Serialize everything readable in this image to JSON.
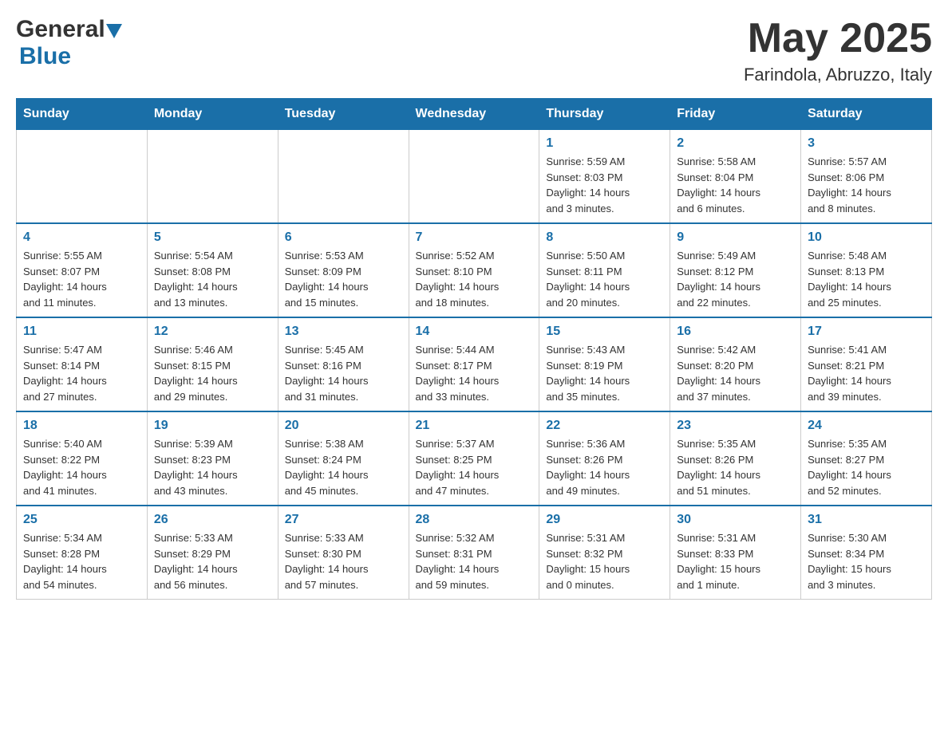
{
  "header": {
    "title": "May 2025",
    "subtitle": "Farindola, Abruzzo, Italy",
    "logo_general": "General",
    "logo_blue": "Blue"
  },
  "weekdays": [
    "Sunday",
    "Monday",
    "Tuesday",
    "Wednesday",
    "Thursday",
    "Friday",
    "Saturday"
  ],
  "weeks": [
    [
      {
        "day": "",
        "info": ""
      },
      {
        "day": "",
        "info": ""
      },
      {
        "day": "",
        "info": ""
      },
      {
        "day": "",
        "info": ""
      },
      {
        "day": "1",
        "info": "Sunrise: 5:59 AM\nSunset: 8:03 PM\nDaylight: 14 hours\nand 3 minutes."
      },
      {
        "day": "2",
        "info": "Sunrise: 5:58 AM\nSunset: 8:04 PM\nDaylight: 14 hours\nand 6 minutes."
      },
      {
        "day": "3",
        "info": "Sunrise: 5:57 AM\nSunset: 8:06 PM\nDaylight: 14 hours\nand 8 minutes."
      }
    ],
    [
      {
        "day": "4",
        "info": "Sunrise: 5:55 AM\nSunset: 8:07 PM\nDaylight: 14 hours\nand 11 minutes."
      },
      {
        "day": "5",
        "info": "Sunrise: 5:54 AM\nSunset: 8:08 PM\nDaylight: 14 hours\nand 13 minutes."
      },
      {
        "day": "6",
        "info": "Sunrise: 5:53 AM\nSunset: 8:09 PM\nDaylight: 14 hours\nand 15 minutes."
      },
      {
        "day": "7",
        "info": "Sunrise: 5:52 AM\nSunset: 8:10 PM\nDaylight: 14 hours\nand 18 minutes."
      },
      {
        "day": "8",
        "info": "Sunrise: 5:50 AM\nSunset: 8:11 PM\nDaylight: 14 hours\nand 20 minutes."
      },
      {
        "day": "9",
        "info": "Sunrise: 5:49 AM\nSunset: 8:12 PM\nDaylight: 14 hours\nand 22 minutes."
      },
      {
        "day": "10",
        "info": "Sunrise: 5:48 AM\nSunset: 8:13 PM\nDaylight: 14 hours\nand 25 minutes."
      }
    ],
    [
      {
        "day": "11",
        "info": "Sunrise: 5:47 AM\nSunset: 8:14 PM\nDaylight: 14 hours\nand 27 minutes."
      },
      {
        "day": "12",
        "info": "Sunrise: 5:46 AM\nSunset: 8:15 PM\nDaylight: 14 hours\nand 29 minutes."
      },
      {
        "day": "13",
        "info": "Sunrise: 5:45 AM\nSunset: 8:16 PM\nDaylight: 14 hours\nand 31 minutes."
      },
      {
        "day": "14",
        "info": "Sunrise: 5:44 AM\nSunset: 8:17 PM\nDaylight: 14 hours\nand 33 minutes."
      },
      {
        "day": "15",
        "info": "Sunrise: 5:43 AM\nSunset: 8:19 PM\nDaylight: 14 hours\nand 35 minutes."
      },
      {
        "day": "16",
        "info": "Sunrise: 5:42 AM\nSunset: 8:20 PM\nDaylight: 14 hours\nand 37 minutes."
      },
      {
        "day": "17",
        "info": "Sunrise: 5:41 AM\nSunset: 8:21 PM\nDaylight: 14 hours\nand 39 minutes."
      }
    ],
    [
      {
        "day": "18",
        "info": "Sunrise: 5:40 AM\nSunset: 8:22 PM\nDaylight: 14 hours\nand 41 minutes."
      },
      {
        "day": "19",
        "info": "Sunrise: 5:39 AM\nSunset: 8:23 PM\nDaylight: 14 hours\nand 43 minutes."
      },
      {
        "day": "20",
        "info": "Sunrise: 5:38 AM\nSunset: 8:24 PM\nDaylight: 14 hours\nand 45 minutes."
      },
      {
        "day": "21",
        "info": "Sunrise: 5:37 AM\nSunset: 8:25 PM\nDaylight: 14 hours\nand 47 minutes."
      },
      {
        "day": "22",
        "info": "Sunrise: 5:36 AM\nSunset: 8:26 PM\nDaylight: 14 hours\nand 49 minutes."
      },
      {
        "day": "23",
        "info": "Sunrise: 5:35 AM\nSunset: 8:26 PM\nDaylight: 14 hours\nand 51 minutes."
      },
      {
        "day": "24",
        "info": "Sunrise: 5:35 AM\nSunset: 8:27 PM\nDaylight: 14 hours\nand 52 minutes."
      }
    ],
    [
      {
        "day": "25",
        "info": "Sunrise: 5:34 AM\nSunset: 8:28 PM\nDaylight: 14 hours\nand 54 minutes."
      },
      {
        "day": "26",
        "info": "Sunrise: 5:33 AM\nSunset: 8:29 PM\nDaylight: 14 hours\nand 56 minutes."
      },
      {
        "day": "27",
        "info": "Sunrise: 5:33 AM\nSunset: 8:30 PM\nDaylight: 14 hours\nand 57 minutes."
      },
      {
        "day": "28",
        "info": "Sunrise: 5:32 AM\nSunset: 8:31 PM\nDaylight: 14 hours\nand 59 minutes."
      },
      {
        "day": "29",
        "info": "Sunrise: 5:31 AM\nSunset: 8:32 PM\nDaylight: 15 hours\nand 0 minutes."
      },
      {
        "day": "30",
        "info": "Sunrise: 5:31 AM\nSunset: 8:33 PM\nDaylight: 15 hours\nand 1 minute."
      },
      {
        "day": "31",
        "info": "Sunrise: 5:30 AM\nSunset: 8:34 PM\nDaylight: 15 hours\nand 3 minutes."
      }
    ]
  ]
}
